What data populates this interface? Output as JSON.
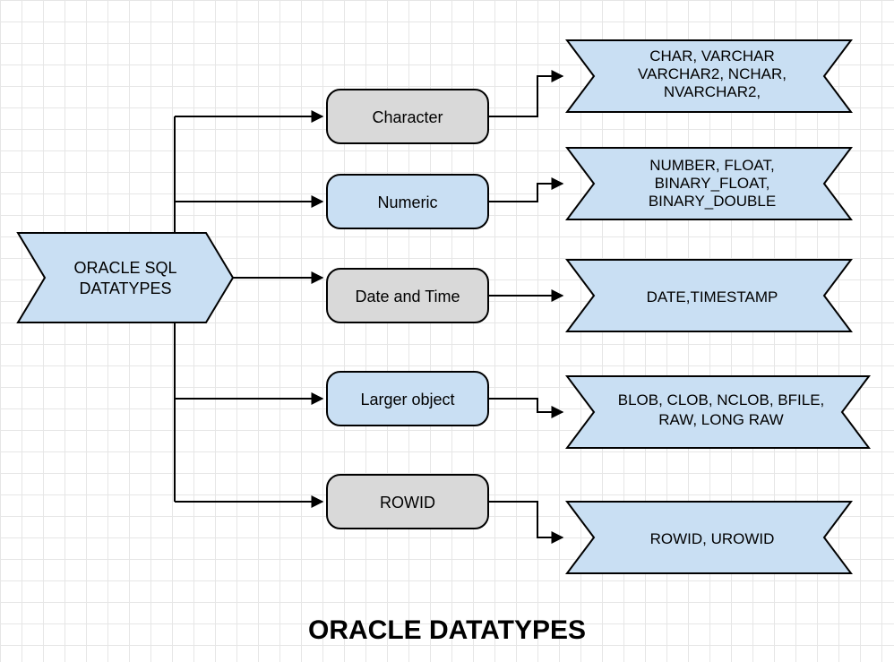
{
  "root": {
    "label_line1": "ORACLE SQL",
    "label_line2": "DATATYPES"
  },
  "categories": [
    {
      "label": "Character",
      "color": "grey",
      "examples": [
        "CHAR, VARCHAR",
        "VARCHAR2, NCHAR,",
        "NVARCHAR2,"
      ]
    },
    {
      "label": "Numeric",
      "color": "blue",
      "examples": [
        "NUMBER, FLOAT,",
        "BINARY_FLOAT,",
        "BINARY_DOUBLE"
      ]
    },
    {
      "label": "Date and Time",
      "color": "grey",
      "examples": [
        "DATE,TIMESTAMP"
      ]
    },
    {
      "label": "Larger object",
      "color": "blue",
      "examples": [
        "BLOB, CLOB, NCLOB, BFILE,",
        "RAW, LONG RAW"
      ]
    },
    {
      "label": "ROWID",
      "color": "grey",
      "examples": [
        "ROWID, UROWID"
      ]
    }
  ],
  "title": "ORACLE DATATYPES"
}
